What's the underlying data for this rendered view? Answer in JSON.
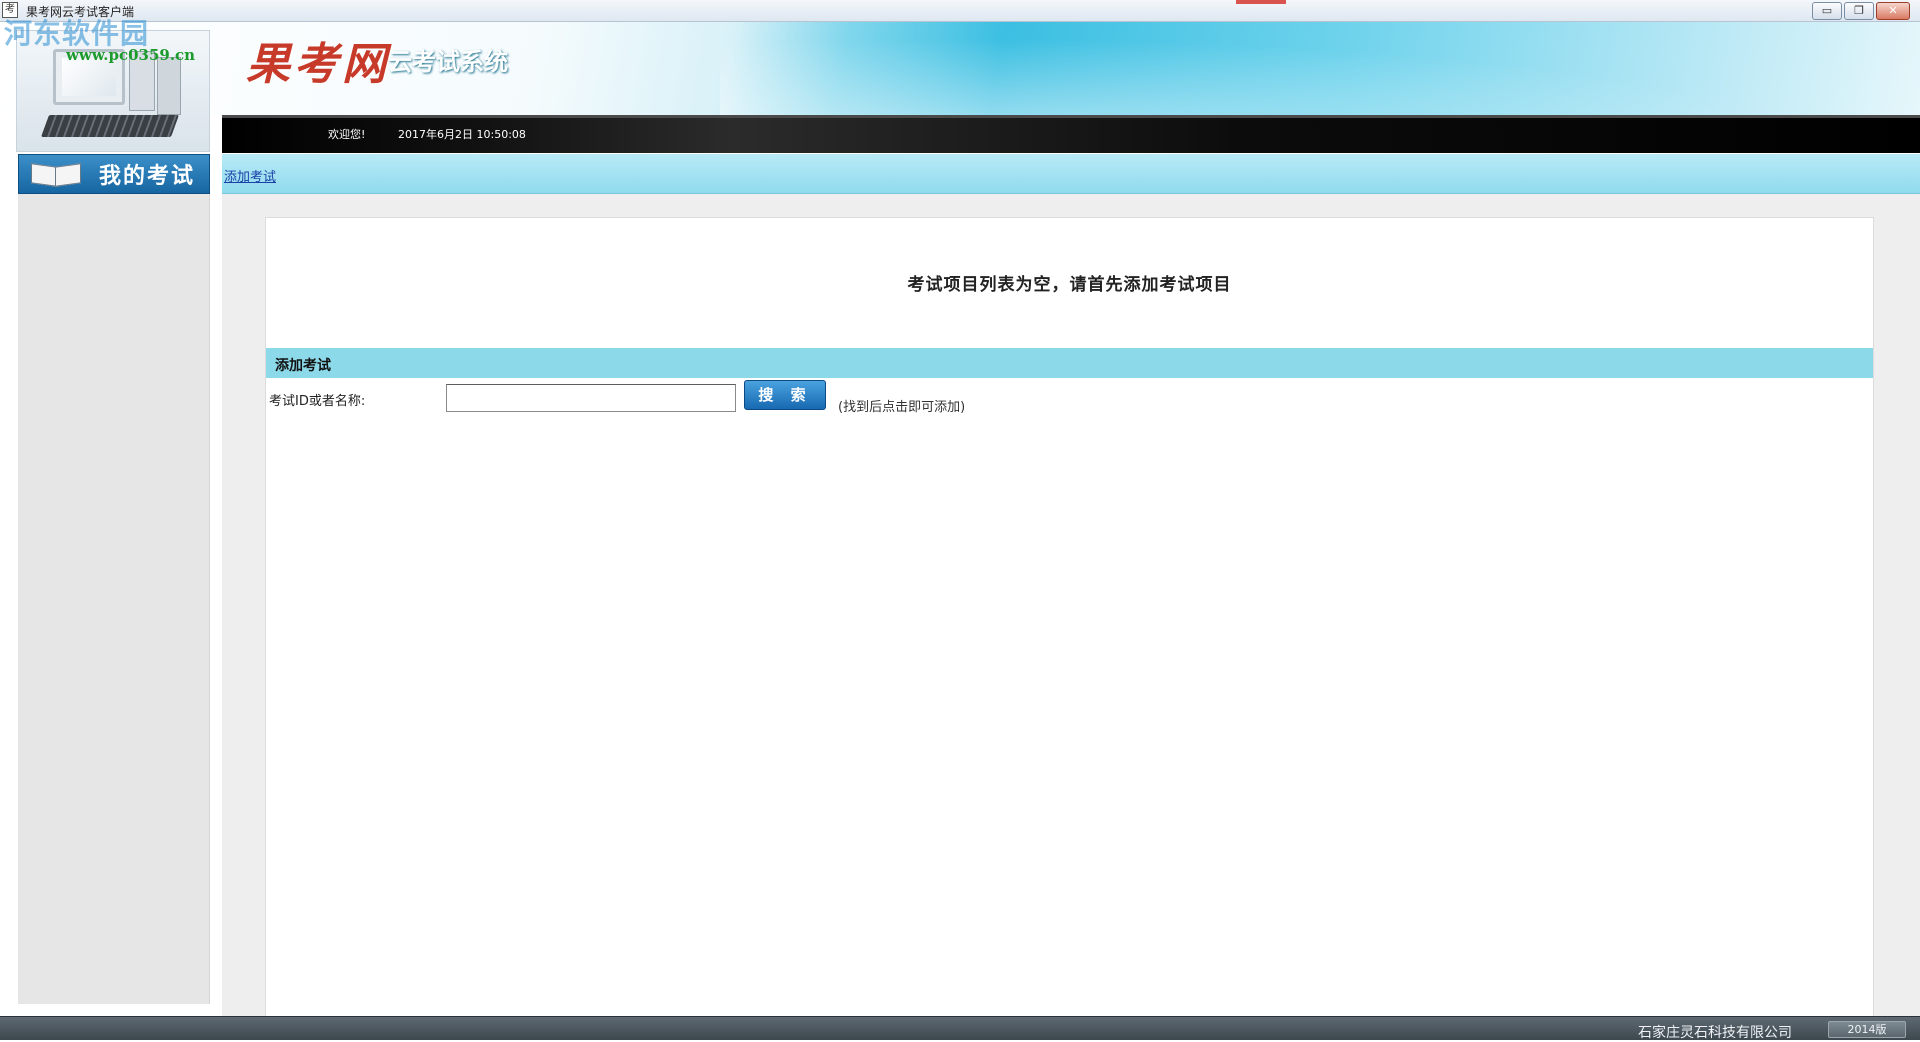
{
  "window": {
    "title": "果考网云考试客户端",
    "app_icon_glyph": "考",
    "controls": {
      "minimize": "▭",
      "restore": "❐",
      "close": "✕"
    }
  },
  "watermark": {
    "text": "河东软件园",
    "url": "www.pc0359.cn"
  },
  "header": {
    "logo_main": "果考网",
    "logo_sub": "云考试系统",
    "welcome": "欢迎您!",
    "datetime": "2017年6月2日 10:50:08"
  },
  "sidebar": {
    "title": "我的考试",
    "icon": "book-icon"
  },
  "toolbar": {
    "add_exam_link": "添加考试"
  },
  "main": {
    "empty_message": "考试项目列表为空，请首先添加考试项目",
    "section_title": "添加考试",
    "field_label": "考试ID或者名称:",
    "search_value": "",
    "search_button": "搜 索",
    "hint": "(找到后点击即可添加)"
  },
  "footer": {
    "company": "石家庄灵石科技有限公司",
    "version": "2014版"
  },
  "colors": {
    "accent_cyan": "#8cd9ea",
    "nav_blue": "#1766a3",
    "logo_red": "#c73a2a"
  }
}
